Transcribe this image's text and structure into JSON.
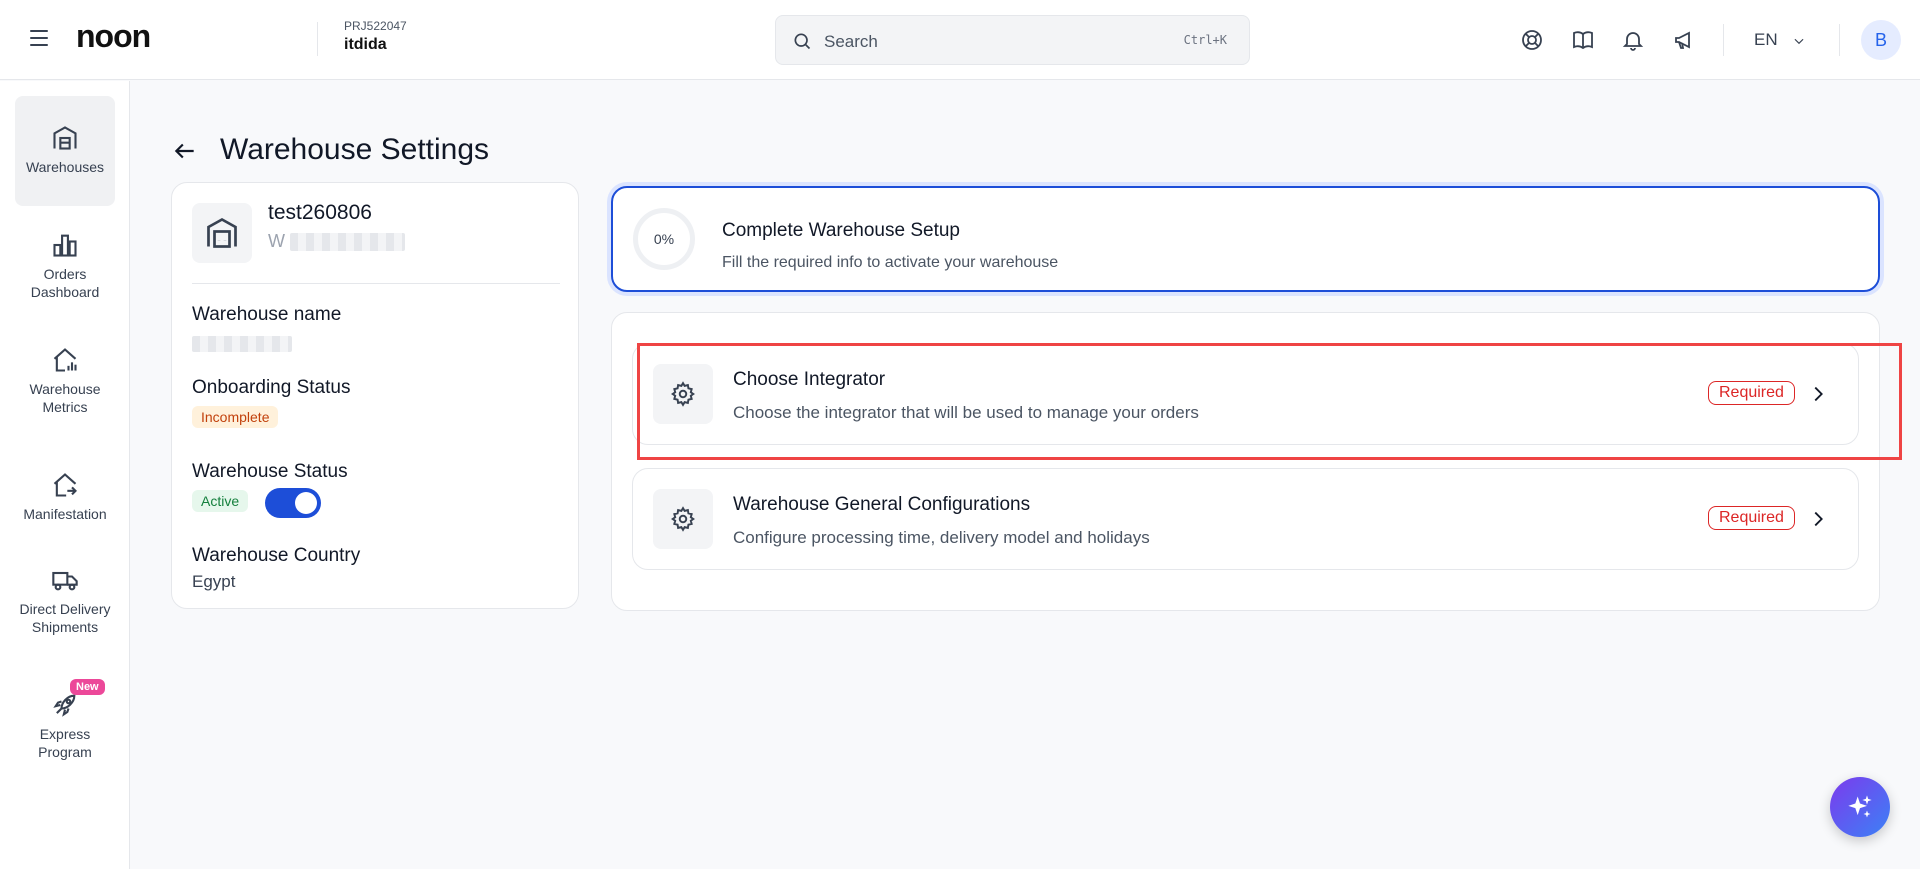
{
  "header": {
    "logo": "noon",
    "project_id": "PRJ522047",
    "project_name": "itdida",
    "search_placeholder": "Search",
    "search_shortcut": "Ctrl+K",
    "language": "EN",
    "avatar_initial": "B"
  },
  "sidebar": {
    "items": [
      {
        "label": "Warehouses",
        "icon": "warehouse-icon",
        "active": true
      },
      {
        "label": "Orders Dashboard",
        "icon": "bar-chart-icon"
      },
      {
        "label": "Warehouse Metrics",
        "icon": "house-chart-icon"
      },
      {
        "label": "Manifestation",
        "icon": "house-arrow-icon"
      },
      {
        "label": "Direct Delivery Shipments",
        "icon": "truck-icon"
      },
      {
        "label": "Express Program",
        "icon": "rocket-icon",
        "badge": "New"
      }
    ]
  },
  "page": {
    "title": "Warehouse Settings"
  },
  "warehouse_card": {
    "code": "test260806",
    "sub_prefix": "W",
    "name_label": "Warehouse name",
    "onboarding_label": "Onboarding Status",
    "onboarding_value": "Incomplete",
    "status_label": "Warehouse Status",
    "status_value": "Active",
    "status_on": true,
    "country_label": "Warehouse Country",
    "country_value": "Egypt"
  },
  "setup": {
    "progress_text": "0%",
    "progress": 0,
    "title": "Complete Warehouse Setup",
    "subtitle": "Fill the required info to activate your warehouse"
  },
  "steps": [
    {
      "title": "Choose Integrator",
      "subtitle": "Choose the integrator that will be used to manage your orders",
      "tag": "Required"
    },
    {
      "title": "Warehouse General Configurations",
      "subtitle": "Configure processing time, delivery model and holidays",
      "tag": "Required"
    }
  ],
  "colors": {
    "accent": "#1d4ed8",
    "required": "#dc2626",
    "highlight": "#ef4444"
  }
}
